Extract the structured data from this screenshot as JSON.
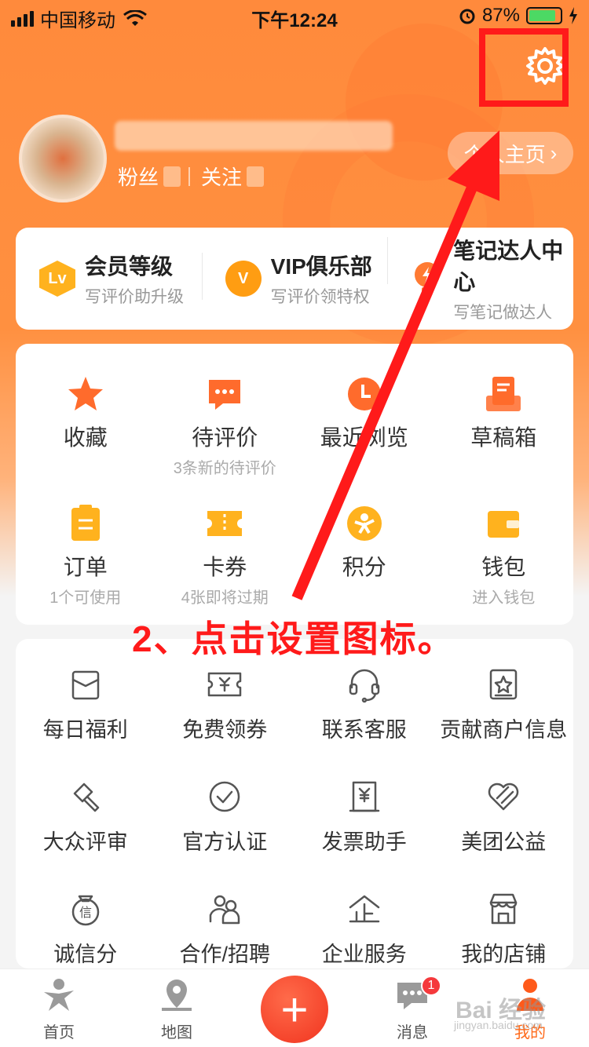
{
  "status": {
    "carrier": "中国移动",
    "time": "下午12:24",
    "battery": "87%"
  },
  "profile": {
    "fans_label": "粉丝",
    "follow_label": "关注",
    "homepage_label": "个人主页"
  },
  "member": [
    {
      "title": "会员等级",
      "sub": "写评价助升级",
      "icon": "lv-badge-icon",
      "icon_text": "Lv",
      "color": "#ffb21e"
    },
    {
      "title": "VIP俱乐部",
      "sub": "写评价领特权",
      "icon": "vip-badge-icon",
      "icon_text": "V",
      "color": "#ff9d12"
    },
    {
      "title": "笔记达人中心",
      "sub": "写笔记做达人",
      "icon": "bulb-icon",
      "icon_text": "",
      "color": "#ff7a32"
    }
  ],
  "grid": [
    {
      "label": "收藏",
      "sub": "",
      "icon": "star-icon",
      "color": "#ff6b2c"
    },
    {
      "label": "待评价",
      "sub": "3条新的待评价",
      "icon": "comment-icon",
      "color": "#ff6b2c"
    },
    {
      "label": "最近浏览",
      "sub": "",
      "icon": "clock-icon",
      "color": "#ff6b2c"
    },
    {
      "label": "草稿箱",
      "sub": "",
      "icon": "draft-icon",
      "color": "#ff6b2c"
    },
    {
      "label": "订单",
      "sub": "1个可使用",
      "icon": "order-icon",
      "color": "#ffb21e"
    },
    {
      "label": "卡券",
      "sub": "4张即将过期",
      "icon": "coupon-icon",
      "color": "#ffb21e"
    },
    {
      "label": "积分",
      "sub": "",
      "icon": "points-icon",
      "color": "#ffb21e"
    },
    {
      "label": "钱包",
      "sub": "进入钱包",
      "icon": "wallet-icon",
      "color": "#ffb21e"
    }
  ],
  "services": [
    {
      "label": "每日福利",
      "icon": "gift-icon"
    },
    {
      "label": "免费领券",
      "icon": "ticket-icon"
    },
    {
      "label": "联系客服",
      "icon": "headset-icon"
    },
    {
      "label": "贡献商户信息",
      "icon": "shop-star-icon"
    },
    {
      "label": "大众评审",
      "icon": "gavel-icon"
    },
    {
      "label": "官方认证",
      "icon": "check-circle-icon"
    },
    {
      "label": "发票助手",
      "icon": "invoice-icon"
    },
    {
      "label": "美团公益",
      "icon": "heart-icon"
    },
    {
      "label": "诚信分",
      "icon": "credit-icon"
    },
    {
      "label": "合作/招聘",
      "icon": "people-icon"
    },
    {
      "label": "企业服务",
      "icon": "enterprise-icon"
    },
    {
      "label": "我的店铺",
      "icon": "store-icon"
    }
  ],
  "annotation": "2、点击设置图标。",
  "tabs": [
    {
      "label": "首页",
      "icon": "home-person-icon"
    },
    {
      "label": "地图",
      "icon": "map-pin-icon"
    },
    {
      "label": "",
      "icon": "plus-icon"
    },
    {
      "label": "消息",
      "icon": "message-icon",
      "badge": "1"
    },
    {
      "label": "我的",
      "icon": "me-icon"
    }
  ],
  "watermark": "Bai 经验",
  "watermark_sub": "jingyan.baidu.com",
  "colors": {
    "accent": "#ff6a1a",
    "annotation_red": "#ff1a1a"
  }
}
